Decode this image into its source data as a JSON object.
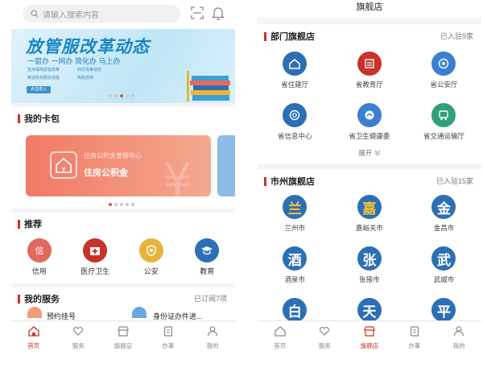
{
  "home": {
    "search_placeholder": "请输入搜索内容",
    "banner": {
      "title": "放管服改革动态",
      "slogan": "一窗办 一网办 简化办 马上办",
      "small_lines": [
        "支持保障放管改革",
        "推进政务服务效能",
        "四办改革动态",
        "简政放权"
      ],
      "button": "点击进入"
    },
    "card_section": {
      "title": "我的卡包",
      "card": {
        "subtitle": "住房公积金管理中心",
        "title": "住房公积金"
      }
    },
    "recommend": {
      "title": "推荐",
      "items": [
        {
          "label": "信用",
          "icon": "credit-icon",
          "color": "#e06a5e"
        },
        {
          "label": "医疗卫生",
          "icon": "medical-icon",
          "color": "#c9312a"
        },
        {
          "label": "公安",
          "icon": "police-icon",
          "color": "#e5b43a"
        },
        {
          "label": "教育",
          "icon": "education-icon",
          "color": "#2c6fb5"
        }
      ]
    },
    "my_services": {
      "title": "我的服务",
      "right": "已订阅7项",
      "items": [
        "预约挂号",
        "身份证办件进..."
      ]
    },
    "tabs": [
      "首页",
      "服务",
      "旗舰店",
      "办事",
      "我的"
    ]
  },
  "flagship": {
    "title": "旗舰店",
    "dept": {
      "title": "部门旗舰店",
      "count": "已入驻9家",
      "items": [
        {
          "label": "省住建厅",
          "color": "#2c6fb5",
          "icon": "house-icon"
        },
        {
          "label": "省教育厅",
          "color": "#c9312a",
          "icon": "education-icon"
        },
        {
          "label": "省公安厅",
          "color": "#3a7fd0",
          "icon": "police-icon"
        },
        {
          "label": "省信息中心",
          "color": "#2c6fb5",
          "icon": "info-icon"
        },
        {
          "label": "省卫生健康委",
          "color": "#3a7fd0",
          "icon": "health-icon"
        },
        {
          "label": "省交通运输厅",
          "color": "#2ea17a",
          "icon": "transport-icon"
        }
      ],
      "expand": "展开"
    },
    "city": {
      "title": "市州旗舰店",
      "count": "已入驻15家",
      "items": [
        {
          "char": "兰",
          "label": "兰州市"
        },
        {
          "char": "嘉",
          "label": "嘉峪关市"
        },
        {
          "char": "金",
          "label": "金昌市"
        },
        {
          "char": "酒",
          "label": "酒泉市"
        },
        {
          "char": "张",
          "label": "张掖市"
        },
        {
          "char": "武",
          "label": "武威市"
        },
        {
          "char": "白",
          "label": ""
        },
        {
          "char": "天",
          "label": ""
        },
        {
          "char": "平",
          "label": ""
        }
      ]
    },
    "tabs": [
      "首页",
      "服务",
      "旗舰店",
      "办事",
      "我的"
    ]
  },
  "colors": {
    "accent": "#c9312a",
    "blue": "#2c6fb5",
    "city_char": "#f3c43a"
  }
}
